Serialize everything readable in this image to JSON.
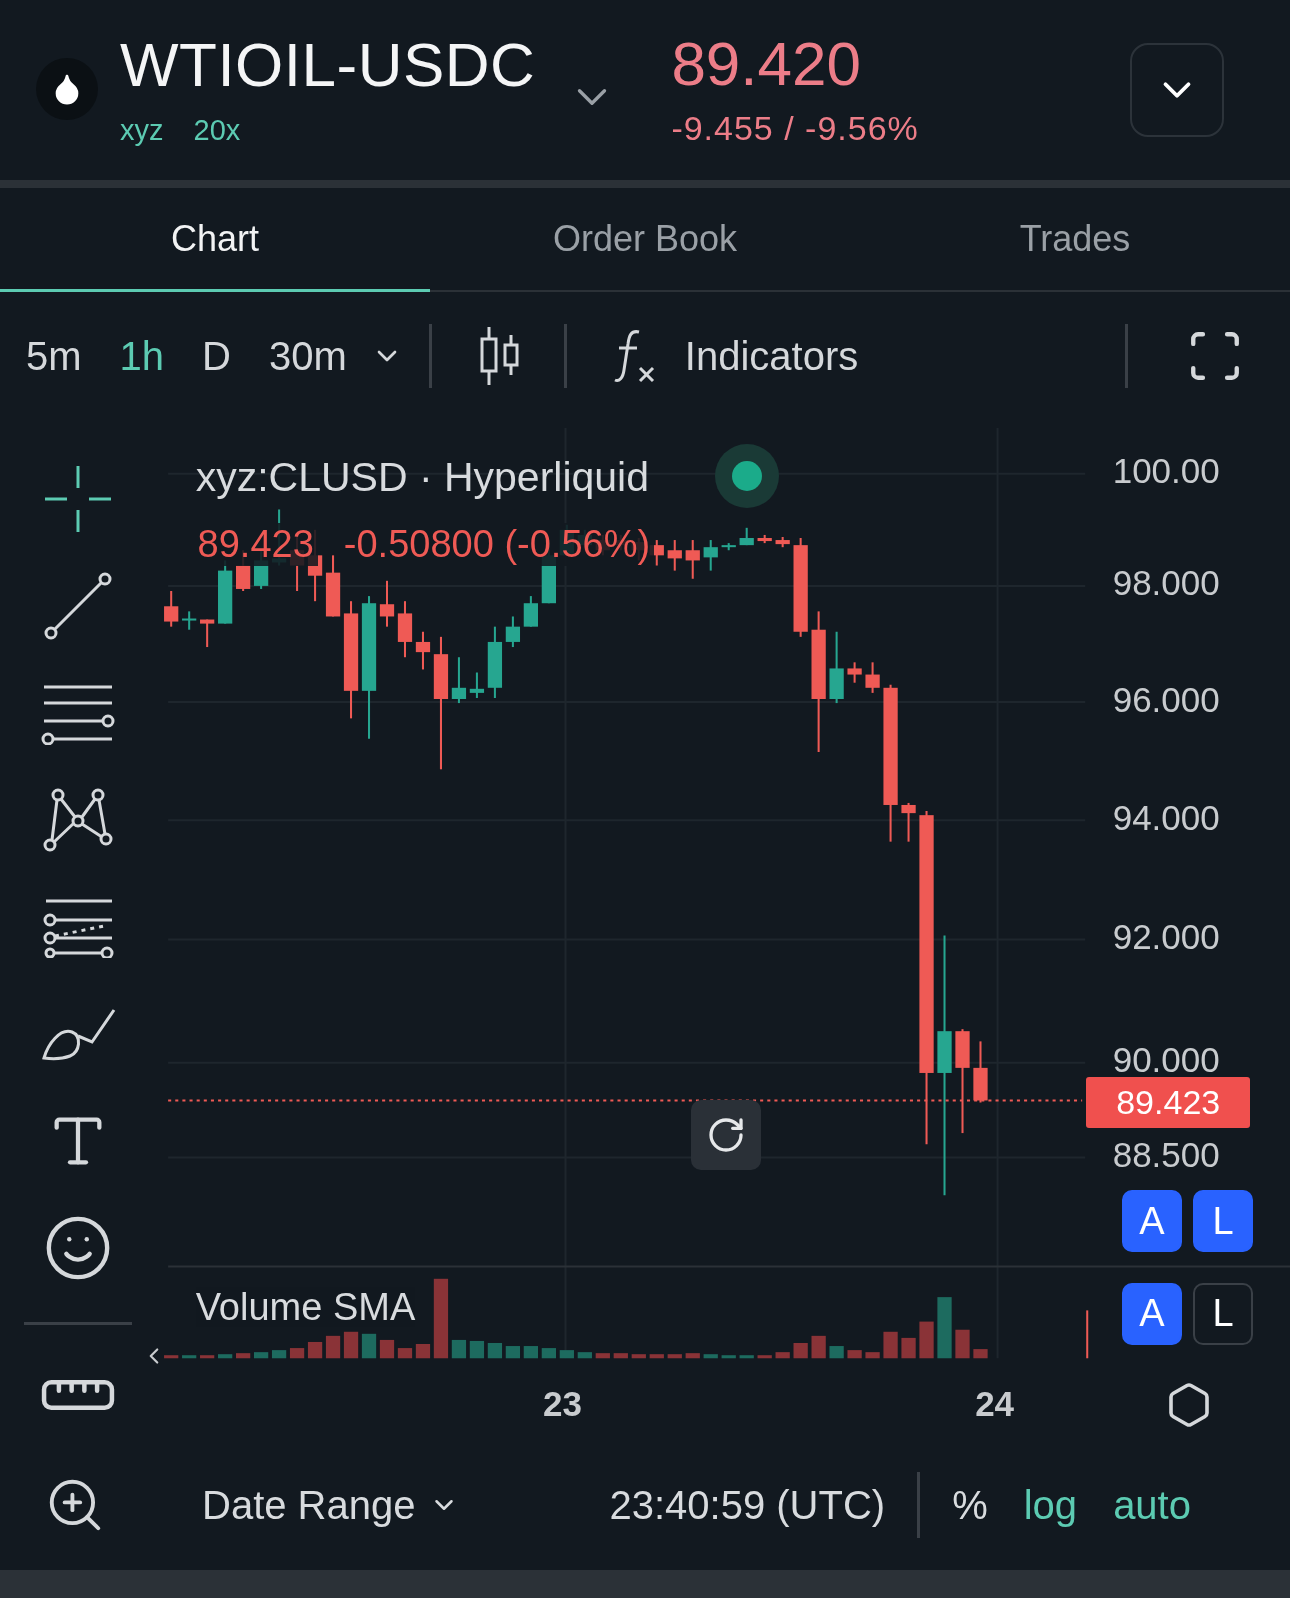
{
  "header": {
    "symbol": "WTIOIL-USDC",
    "tags": [
      "xyz",
      "20x"
    ],
    "price": "89.420",
    "change": "-9.455 / -9.56%"
  },
  "tabs": [
    {
      "label": "Chart",
      "selected": true
    },
    {
      "label": "Order Book",
      "selected": false
    },
    {
      "label": "Trades",
      "selected": false
    }
  ],
  "toolbar": {
    "intervals": [
      {
        "label": "5m",
        "selected": false
      },
      {
        "label": "1h",
        "selected": true
      },
      {
        "label": "D",
        "selected": false
      },
      {
        "label": "30m",
        "selected": false
      }
    ],
    "indicators": "Indicators"
  },
  "chart": {
    "legend_title": "xyz:CLUSD · Hyperliquid",
    "legend_price": "89.423",
    "legend_change": "-0.50800 (-0.56%)",
    "price_axis": [
      "100.00",
      "98.000",
      "96.000",
      "94.000",
      "92.000",
      "90.000",
      "88.500"
    ],
    "last_price": "89.423",
    "time_axis": [
      "23",
      "24"
    ],
    "volume_label": "Volume SMA",
    "scale_buttons": [
      {
        "label": "A",
        "on": true
      },
      {
        "label": "L",
        "on": true
      },
      {
        "label": "A",
        "on": true
      },
      {
        "label": "L",
        "on": false
      }
    ]
  },
  "footer": {
    "date_range": "Date Range",
    "clock": "23:40:59 (UTC)",
    "options": [
      {
        "label": "%",
        "on": false
      },
      {
        "label": "log",
        "on": true
      },
      {
        "label": "auto",
        "on": true
      }
    ]
  }
}
